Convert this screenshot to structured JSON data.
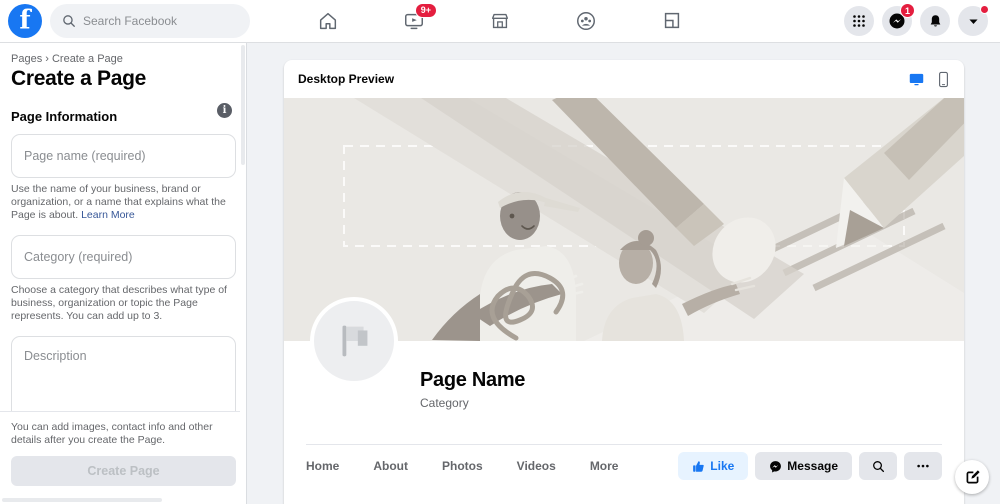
{
  "topbar": {
    "logo": "facebook-logo",
    "search": {
      "placeholder": "Search Facebook",
      "icon": "search-icon"
    },
    "nav": [
      {
        "name": "home",
        "icon": "home-icon",
        "badge": ""
      },
      {
        "name": "watch",
        "icon": "video-icon",
        "badge": "9+"
      },
      {
        "name": "marketplace",
        "icon": "store-icon",
        "badge": ""
      },
      {
        "name": "groups",
        "icon": "groups-icon",
        "badge": ""
      },
      {
        "name": "gaming",
        "icon": "gaming-icon",
        "badge": ""
      }
    ],
    "right": [
      {
        "name": "menu",
        "icon": "grid-menu-icon",
        "badge": ""
      },
      {
        "name": "messenger",
        "icon": "messenger-icon",
        "badge": "1"
      },
      {
        "name": "notifications",
        "icon": "bell-icon",
        "badge": ""
      },
      {
        "name": "account",
        "icon": "chevron-down-icon",
        "badge": "dot"
      }
    ]
  },
  "sidebar": {
    "breadcrumb": "Pages › Create a Page",
    "title": "Create a Page",
    "info_icon": "i",
    "section_label": "Page Information",
    "fields": [
      {
        "name": "page-name",
        "placeholder": "Page name (required)",
        "value": "",
        "helper": "Use the name of your business, brand or organization, or a name that explains what the Page is about.",
        "helper_link": "Learn More"
      },
      {
        "name": "category",
        "placeholder": "Category (required)",
        "value": "",
        "helper": "Choose a category that describes what type of business, organization or topic the Page represents. You can add up to 3.",
        "helper_link": ""
      },
      {
        "name": "description",
        "placeholder": "Description",
        "value": "",
        "helper": "",
        "helper_link": ""
      }
    ],
    "footer_note": "You can add images, contact info and other details after you create the Page.",
    "create_button": "Create Page",
    "create_button_enabled": false
  },
  "preview": {
    "title": "Desktop Preview",
    "devices": [
      {
        "name": "desktop",
        "icon": "desktop-icon",
        "active": true
      },
      {
        "name": "mobile",
        "icon": "mobile-icon",
        "active": false
      }
    ],
    "cover_alt": "page-cover-illustration",
    "avatar_icon": "flag-icon",
    "page_name": "Page Name",
    "page_category": "Category",
    "tabs": [
      "Home",
      "About",
      "Photos",
      "Videos",
      "More"
    ],
    "actions": [
      {
        "name": "like",
        "label": "Like",
        "icon": "thumbs-up-icon"
      },
      {
        "name": "message",
        "label": "Message",
        "icon": "messenger-icon"
      },
      {
        "name": "search",
        "label": "",
        "icon": "search-icon"
      },
      {
        "name": "more",
        "label": "",
        "icon": "ellipsis-icon"
      }
    ]
  },
  "fab": {
    "name": "compose",
    "icon": "compose-icon"
  },
  "colors": {
    "brand": "#1877f2",
    "badge": "#e41e3f",
    "page_bg": "#f0f2f5",
    "card_bg": "#ffffff",
    "muted_text": "#65676b",
    "cover_bg": "#eae8e4"
  }
}
